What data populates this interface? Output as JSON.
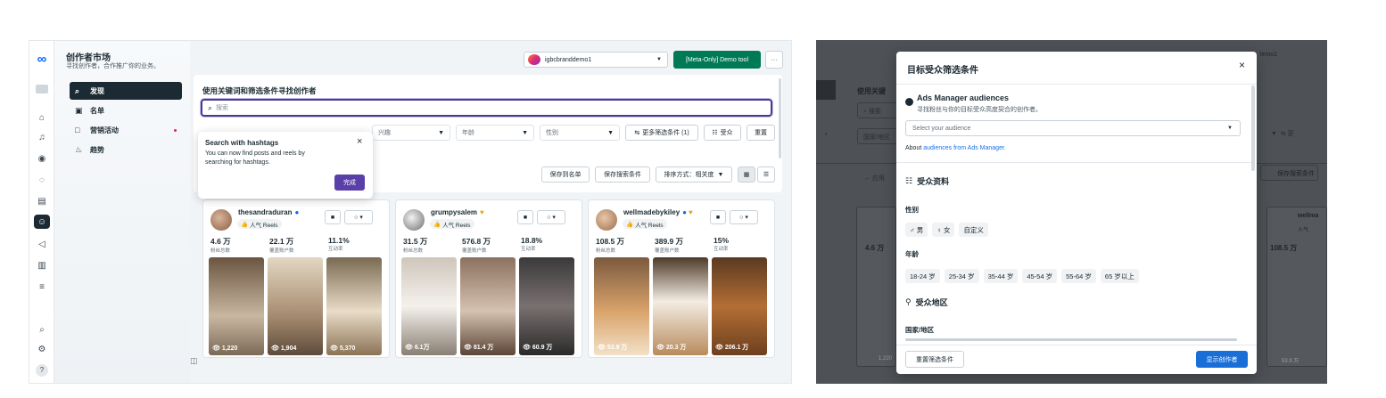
{
  "left": {
    "app_title": "创作者市场",
    "app_subtitle": "寻找创作者，合作推广你的业务。",
    "nav": [
      {
        "label": "发现",
        "icon": "search-icon",
        "active": true
      },
      {
        "label": "名单",
        "icon": "list-icon"
      },
      {
        "label": "营销活动",
        "icon": "folder-icon",
        "dot": true
      },
      {
        "label": "趋势",
        "icon": "trend-icon"
      }
    ],
    "account": "igbcbranddemo1",
    "demo_tool": "[Meta-Only] Demo tool",
    "more": "···",
    "search_heading": "使用关键词和筛选条件寻找创作者",
    "search_placeholder": "搜索",
    "filters": {
      "interest": "兴趣",
      "age": "年龄",
      "gender": "性别",
      "more": "更多筛选条件 (1)",
      "audience": "受众",
      "reset": "重置"
    },
    "tooltip": {
      "title": "Search with hashtags",
      "body": "You can now find posts and reels by searching for hashtags.",
      "done": "完成"
    },
    "toolbar": {
      "save_list": "保存到名单",
      "save_search": "保存搜索条件",
      "sort": "排序方式：相关度"
    },
    "creators": [
      {
        "name": "thesandraduran",
        "tag": "人气 Reels",
        "followers": "4.6 万",
        "reach": "22.1 万",
        "engagement": "11.1%",
        "views": [
          "1,220",
          "1,904",
          "5,370"
        ]
      },
      {
        "name": "grumpysalem",
        "tag": "人气 Reels",
        "followers": "31.5 万",
        "reach": "576.8 万",
        "engagement": "18.8%",
        "views": [
          "6.1万",
          "81.4 万",
          "60.9 万"
        ]
      },
      {
        "name": "wellmadebykiley",
        "tag": "人气 Reels",
        "followers": "108.5 万",
        "reach": "389.9 万",
        "engagement": "15%",
        "views": [
          "53.9 万",
          "20.3 万",
          "206.1 万"
        ]
      }
    ],
    "stat_labels": {
      "followers": "粉丝总数",
      "reach": "覆盖账户数",
      "engagement": "互动率"
    }
  },
  "right": {
    "modal_title": "目标受众筛选条件",
    "close": "×",
    "ads_title": "Ads Manager audiences",
    "ads_desc": "寻找粉丝与你的目标受众高度契合的创作者。",
    "select_placeholder": "Select your audience",
    "about_prefix": "About",
    "about_link": "audiences from Ads Manager.",
    "profile_title": "受众资料",
    "gender_label": "性别",
    "genders": [
      "男",
      "女",
      "自定义"
    ],
    "age_label": "年龄",
    "ages": [
      "18-24 岁",
      "25-34 岁",
      "35-44 岁",
      "45-54 岁",
      "55-64 岁",
      "65 岁以上"
    ],
    "region_title": "受众地区",
    "country_label": "国家/地区",
    "reset_btn": "重置筛选条件",
    "show_btn": "显示创作者",
    "bg_account": "lemo1",
    "bg_heading": "使用关键",
    "bg_search": "搜索",
    "bg_country": "国家/地区",
    "bg_apply": "应用",
    "bg_save_search": "保存搜索条件",
    "bg_more": "更",
    "bg_name": "wellma",
    "bg_tag": "人气",
    "bg_followers": "4.6 万",
    "bg_followers2": "108.5 万",
    "bg_views1": "1,220",
    "bg_views2": "53.9 万"
  }
}
